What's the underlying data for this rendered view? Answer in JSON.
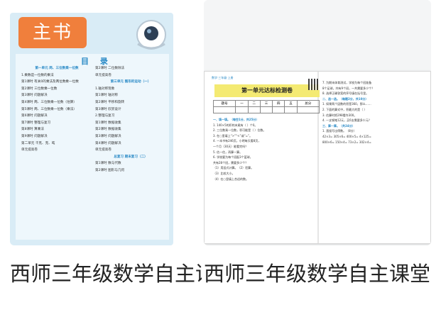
{
  "products": [
    {
      "badge": "主书",
      "toc_title": "目 录",
      "book": {
        "col_a": [
          {
            "type": "h",
            "text": "第一单元 两、三位数乘一位数"
          },
          {
            "type": "l",
            "text": "1.乘数是一位数的乘法"
          },
          {
            "type": "l",
            "text": "第1课时 有关0的乘法及两位数乘一位数"
          },
          {
            "type": "l",
            "text": "第2课时 三位数乘一位数"
          },
          {
            "type": "l",
            "text": "第3课时 问题解决"
          },
          {
            "type": "l",
            "text": "第4课时 两、三位数乘一位数（估算）"
          },
          {
            "type": "l",
            "text": "第5课时 两、三位数乘一位数（乘法）"
          },
          {
            "type": "l",
            "text": "第6课时 问题解决"
          },
          {
            "type": "l",
            "text": "第7课时 整理与复习"
          },
          {
            "type": "l",
            "text": "第8课时 算乘法"
          },
          {
            "type": "l",
            "text": "第9课时 问题解决"
          },
          {
            "type": "l",
            "text": "第二单元 千克、克、吨"
          },
          {
            "type": "l",
            "text": "单元提高卷"
          }
        ],
        "col_b": [
          {
            "type": "l",
            "text": "第2课时 二位数除法"
          },
          {
            "type": "l",
            "text": "单元提高卷"
          },
          {
            "type": "h",
            "text": "第三单元 图形的运动（一）"
          },
          {
            "type": "l",
            "text": "1.轴对称现象"
          },
          {
            "type": "l",
            "text": "第1课时 轴对称"
          },
          {
            "type": "l",
            "text": "第2课时 平移和旋转"
          },
          {
            "type": "l",
            "text": "第3课时 欣赏设计"
          },
          {
            "type": "l",
            "text": "2.整理与复习"
          },
          {
            "type": "l",
            "text": "第1课时 数据收集"
          },
          {
            "type": "l",
            "text": "第2课时 数据收集"
          },
          {
            "type": "l",
            "text": "第3课时 问题解决"
          },
          {
            "type": "l",
            "text": "第4课时 问题解决"
          },
          {
            "type": "l",
            "text": "单元提高卷"
          },
          {
            "type": "h",
            "text": "总复习 期末复习（二）"
          },
          {
            "type": "l",
            "text": "第1课时 数与代数"
          },
          {
            "type": "l",
            "text": "第2课时 图形与几何"
          }
        ]
      },
      "caption": "西师三年级数学自主课堂主书-"
    },
    {
      "paper": {
        "tag": "数学·三年级·上册",
        "title": "第一单元达标检测卷",
        "score_cells": [
          "题号",
          "一",
          "二",
          "三",
          "四",
          "五",
          "总分"
        ],
        "col_a": [
          {
            "type": "s",
            "text": "一、填一填。（每空1分，共25分）"
          },
          {
            "type": "l",
            "text": "1. 140×5的积的末尾有（  ）个0。"
          },
          {
            "type": "l",
            "text": "2. 三位数乘一位数，积可能是（  ）位数。"
          },
          {
            "type": "l",
            "text": "3. 在○里填上“>”“<”或“=”。"
          },
          {
            "type": "l",
            "text": "4. 一本书有246页，小明每天看8页，"
          },
          {
            "type": "l",
            "text": "   一个月（30天）能看完吗？"
          },
          {
            "type": "l",
            "text": "5. 估一估，再算一算。"
          },
          {
            "type": "l",
            "text": "6. 学校要为每个班配3个篮球，"
          },
          {
            "type": "l",
            "text": "   共有28个班，需要多少个？"
          },
          {
            "type": "l",
            "text": "（1）用竖式计算。（2）验算。"
          },
          {
            "type": "l",
            "text": "（3）比较大小。"
          },
          {
            "type": "l",
            "text": "（4）在○里填上合适的数。"
          }
        ],
        "col_b": [
          {
            "type": "l",
            "text": "7. 为期末体育测试，学校为每个班准备"
          },
          {
            "type": "l",
            "text": "   8个足球，共有9个班，一共需要多少个？"
          },
          {
            "type": "l",
            "text": "8. 选择正确答案的序号填在括号里。"
          },
          {
            "type": "s",
            "text": "二、选一选。（每题2分，共10分）"
          },
          {
            "type": "l",
            "text": "1. 如果两个因数的积是360，那么……"
          },
          {
            "type": "l",
            "text": "2. 下面的算式中，积最大的是（  ）"
          },
          {
            "type": "l",
            "text": "3. 估算时把298看作300。"
          },
          {
            "type": "l",
            "text": "4. 一支钢笔12元，买6支需要多少元？"
          },
          {
            "type": "s",
            "text": "三、算一算。（共24分）"
          },
          {
            "type": "l",
            "text": "1. 直接写出得数。（8分）"
          },
          {
            "type": "l",
            "text": "42×3=  305×6=  400×5=  4×125="
          },
          {
            "type": "l",
            "text": "800×6=  150×4=  73×2=  302×4="
          }
        ]
      },
      "caption": "西师三年级数学自主课堂夹卷-学用"
    }
  ]
}
